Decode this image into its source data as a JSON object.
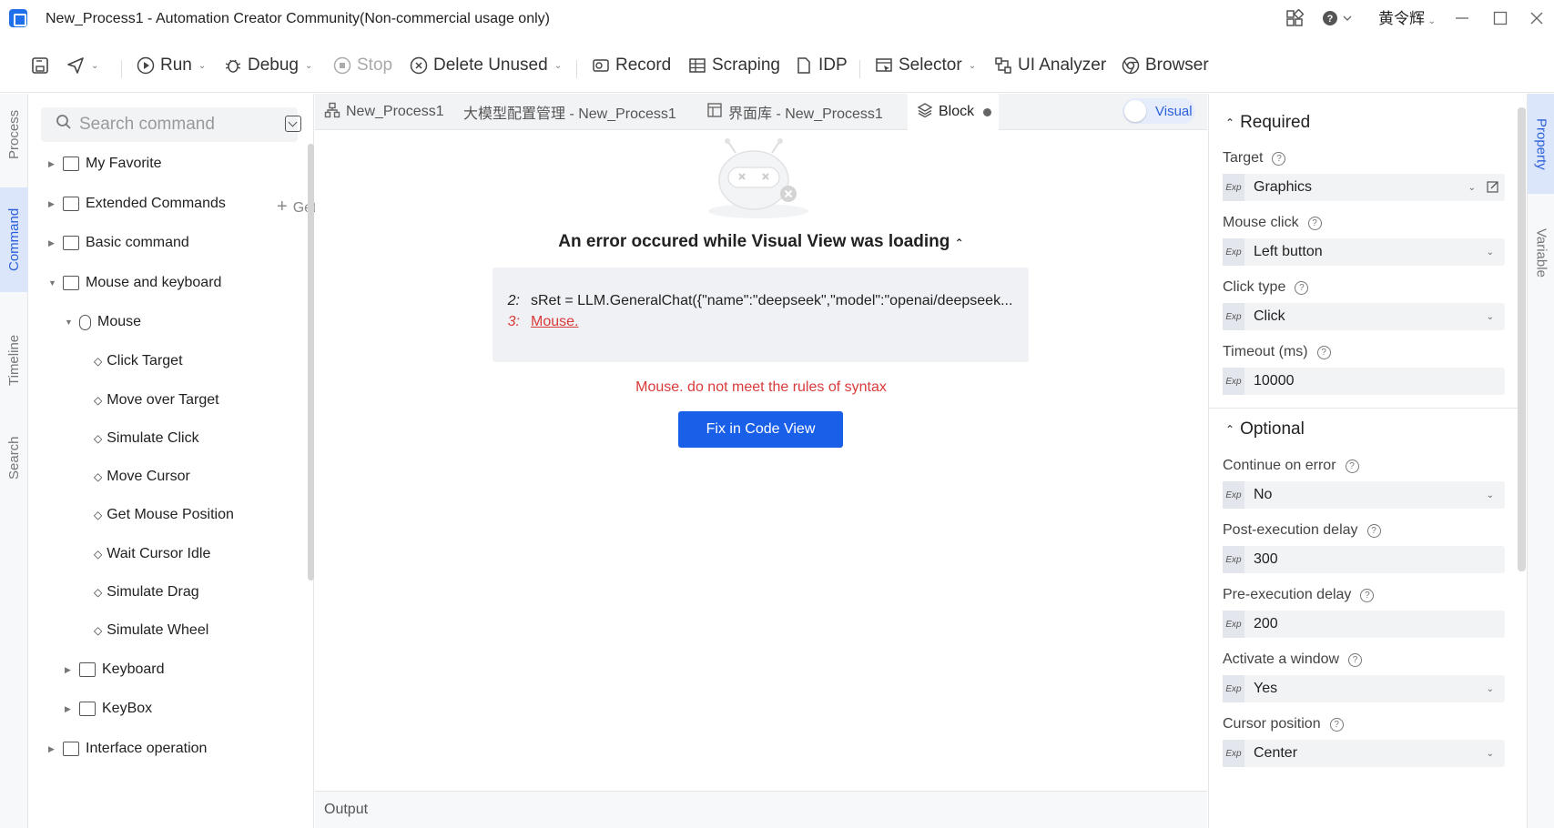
{
  "window": {
    "title": "New_Process1 - Automation Creator Community(Non-commercial usage only)",
    "user": "黄令辉"
  },
  "toolbar": {
    "run": "Run",
    "debug": "Debug",
    "stop": "Stop",
    "delete_unused": "Delete Unused",
    "record": "Record",
    "scraping": "Scraping",
    "idp": "IDP",
    "selector": "Selector",
    "ui_analyzer": "UI Analyzer",
    "browser": "Browser"
  },
  "left_tabs": [
    "Process",
    "Command",
    "Timeline",
    "Search"
  ],
  "command_panel": {
    "search_placeholder": "Search command",
    "get_label": "Get",
    "tree": {
      "my_favorite": "My Favorite",
      "extended_commands": "Extended Commands",
      "basic_command": "Basic command",
      "mouse_and_keyboard": "Mouse and keyboard",
      "mouse": "Mouse",
      "mouse_items": [
        "Click Target",
        "Move over Target",
        "Simulate Click",
        "Move Cursor",
        "Get Mouse Position",
        "Wait Cursor Idle",
        "Simulate Drag",
        "Simulate Wheel"
      ],
      "keyboard": "Keyboard",
      "keybox": "KeyBox",
      "interface_operation": "Interface operation"
    }
  },
  "doc_tabs": [
    "New_Process1",
    "大模型配置管理 - New_Process1",
    "界面库 - New_Process1",
    "Block"
  ],
  "visual_toggle": "Visual",
  "error_view": {
    "title": "An error occured while Visual View was loading",
    "lines": [
      {
        "num": "2:",
        "code": "sRet = LLM.GeneralChat({\"name\":\"deepseek\",\"model\":\"openai/deepseek..."
      },
      {
        "num": "3:",
        "code": "Mouse."
      }
    ],
    "message": "Mouse. do not meet the rules of syntax",
    "fix_button": "Fix in Code View"
  },
  "output_label": "Output",
  "properties": {
    "required_title": "Required",
    "optional_title": "Optional",
    "exp_tag": "Exp",
    "required": [
      {
        "label": "Target",
        "value": "Graphics"
      },
      {
        "label": "Mouse click",
        "value": "Left button"
      },
      {
        "label": "Click type",
        "value": "Click"
      },
      {
        "label": "Timeout (ms)",
        "value": "10000"
      }
    ],
    "optional": [
      {
        "label": "Continue on error",
        "value": "No"
      },
      {
        "label": "Post-execution delay",
        "value": "300"
      },
      {
        "label": "Pre-execution delay",
        "value": "200"
      },
      {
        "label": "Activate a window",
        "value": "Yes"
      },
      {
        "label": "Cursor position",
        "value": "Center"
      }
    ]
  },
  "right_tabs": [
    "Property",
    "Variable"
  ],
  "colors": {
    "accent": "#1a5fe8",
    "error": "#d93a3a",
    "active_tab_bg": "#dbe6fb"
  }
}
